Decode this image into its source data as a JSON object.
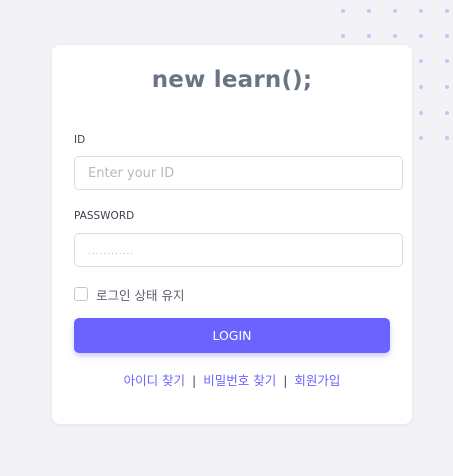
{
  "brand": {
    "title": "new learn();"
  },
  "form": {
    "id_label": "ID",
    "id_placeholder": "Enter your ID",
    "password_label": "PASSWORD",
    "password_placeholder": "............",
    "remember_label": "로그인 상태 유지",
    "remember_checked": false,
    "login_label": "LOGIN"
  },
  "links": {
    "find_id": "아이디 찾기",
    "find_password": "비밀번호 찾기",
    "signup": "회원가입",
    "separator": "|"
  },
  "colors": {
    "accent": "#6c63ff",
    "background": "#f3f3f7",
    "dots": "#c9c5f7",
    "title": "#6b7485"
  }
}
